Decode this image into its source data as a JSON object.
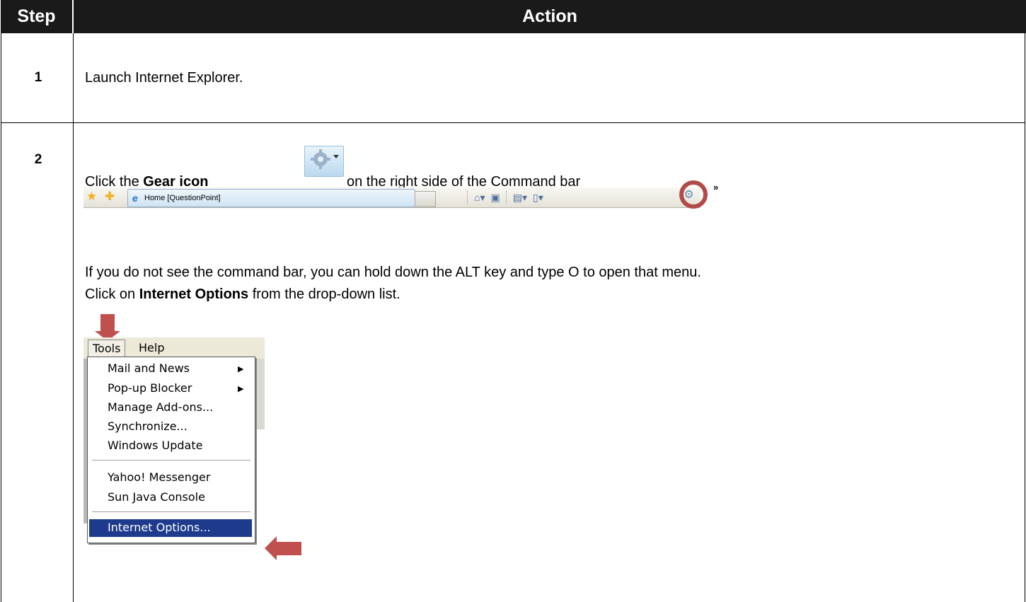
{
  "header": {
    "step_label": "Step",
    "action_label": "Action"
  },
  "rows": [
    {
      "step": "1",
      "text": "Launch Internet Explorer."
    },
    {
      "step": "2",
      "click_prefix": "Click the ",
      "gear_bold": "Gear icon",
      "click_suffix": "on the right side of the Command bar",
      "tab_title": "Home [QuestionPoint]",
      "para1": "If you do not see the command bar, you can hold down the ALT key and type O to open that menu.",
      "para2_prefix": "Click on ",
      "para2_bold": "Internet Options",
      "para2_suffix": " from the drop-down list."
    }
  ],
  "menu": {
    "bar": [
      "Tools",
      "Help"
    ],
    "items": [
      {
        "label": "Mail and News",
        "submenu": true
      },
      {
        "label": "Pop-up Blocker",
        "submenu": true
      },
      {
        "label": "Manage Add-ons...",
        "submenu": false
      },
      {
        "label": "Synchronize...",
        "submenu": false
      },
      {
        "label": "Windows Update",
        "submenu": false
      },
      {
        "label": "Yahoo! Messenger",
        "submenu": false
      },
      {
        "label": "Sun Java Console",
        "submenu": false
      },
      {
        "label": "Internet Options...",
        "submenu": false,
        "highlighted": true
      }
    ]
  },
  "icons": [
    "gear-icon",
    "home-icon",
    "feeds-icon",
    "print-icon",
    "page-icon",
    "star-icon",
    "add-favorite-icon",
    "ie-logo-icon",
    "arrow-down-icon",
    "arrow-left-icon"
  ],
  "colors": {
    "header_bg": "#1a1a1a",
    "arrow": "#c0504d",
    "highlight": "#1d3a8c"
  }
}
